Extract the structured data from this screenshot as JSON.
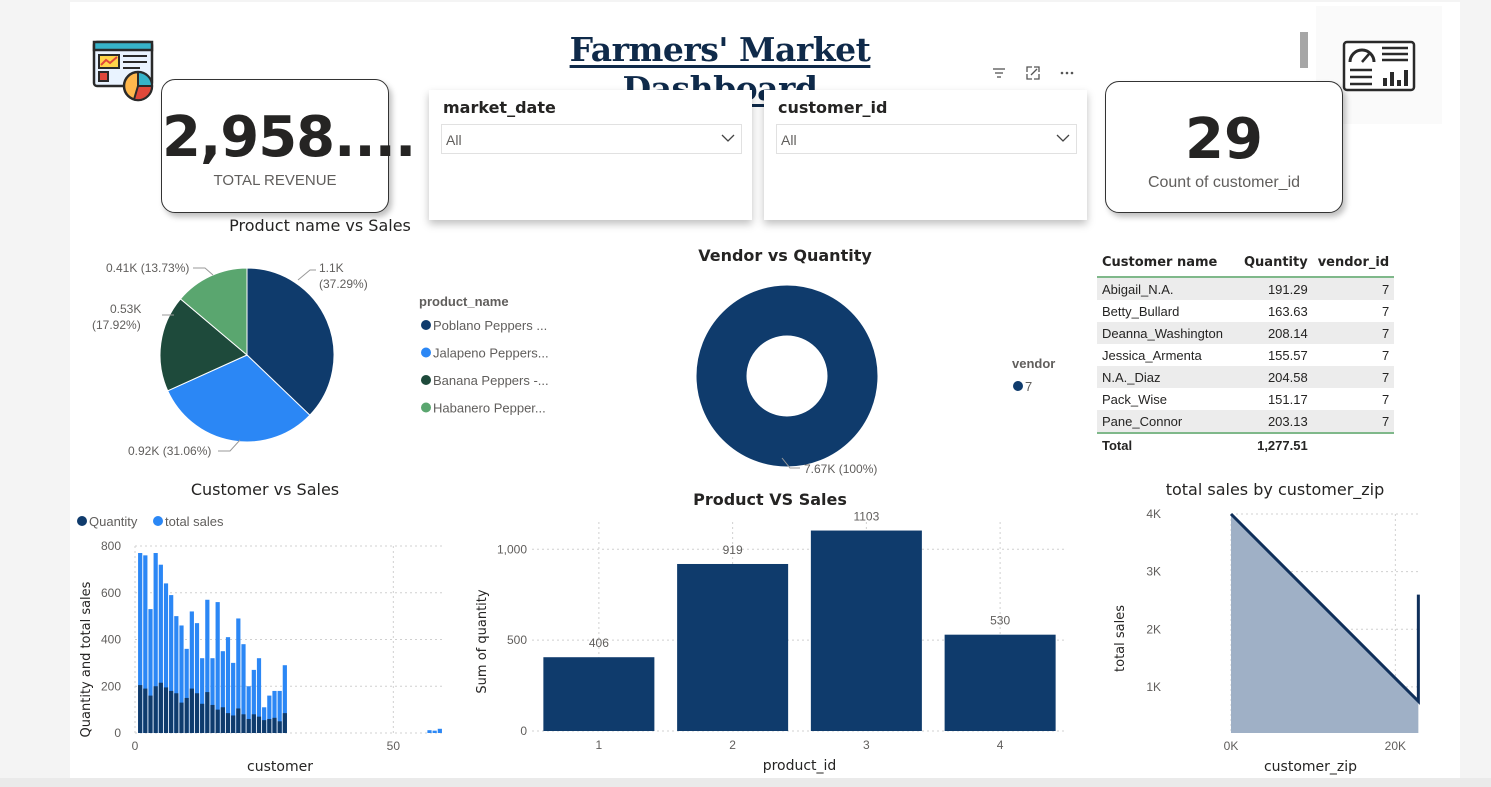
{
  "dashboard": {
    "title": "Farmers' Market Dashboard"
  },
  "kpis": {
    "revenue": {
      "value": "2,958....",
      "label": "TOTAL REVENUE"
    },
    "customers": {
      "value": "29",
      "label": "Count of customer_id"
    }
  },
  "slicers": [
    {
      "header": "market_date",
      "value": "All"
    },
    {
      "header": "customer_id",
      "value": "All"
    }
  ],
  "colors": {
    "navy": "#0f3b6c",
    "blue": "#2b87f5",
    "darkgreen": "#1e4a3b",
    "green": "#5aa66f",
    "area": "#9fb0c6",
    "grid": "#d0d0d0"
  },
  "icons": {
    "toolbar": [
      "filter-icon",
      "focus-mode-icon",
      "more-options-icon"
    ],
    "logo_left": "dashboard-chart-icon",
    "logo_right": "analytics-gauge-icon"
  },
  "table": {
    "columns": [
      "Customer name",
      "Quantity",
      "vendor_id"
    ],
    "rows": [
      [
        "Abigail_N.A.",
        "191.29",
        "7"
      ],
      [
        "Betty_Bullard",
        "163.63",
        "7"
      ],
      [
        "Deanna_Washington",
        "208.14",
        "7"
      ],
      [
        "Jessica_Armenta",
        "155.57",
        "7"
      ],
      [
        "N.A._Diaz",
        "204.58",
        "7"
      ],
      [
        "Pack_Wise",
        "151.17",
        "7"
      ],
      [
        "Pane_Connor",
        "203.13",
        "7"
      ]
    ],
    "total": [
      "Total",
      "1,277.51",
      ""
    ]
  },
  "chart_data": [
    {
      "type": "pie",
      "title": "Product name vs Sales",
      "legend_title": "product_name",
      "legend_position": "right",
      "slices": [
        {
          "name": "Poblano Peppers ...",
          "value": 1.1,
          "label_top": "1.1K",
          "label_bottom": "(37.29%)",
          "color": "#0f3b6c"
        },
        {
          "name": "Jalapeno Peppers...",
          "value": 0.92,
          "label": "0.92K (31.06%)",
          "color": "#2b87f5"
        },
        {
          "name": "Banana Peppers -...",
          "value": 0.53,
          "label_top": "0.53K",
          "label_bottom": "(17.92%)",
          "color": "#1e4a3b"
        },
        {
          "name": "Habanero Pepper...",
          "value": 0.41,
          "label": "0.41K (13.73%)",
          "color": "#5aa66f"
        }
      ]
    },
    {
      "type": "donut",
      "title": "Vendor vs Quantity",
      "legend_title": "vendor",
      "legend_position": "right",
      "slices": [
        {
          "name": "7",
          "value": 7.67,
          "label": "7.67K (100%)",
          "color": "#0f3b6c"
        }
      ]
    },
    {
      "type": "bar",
      "title": "Customer vs Sales",
      "xlabel": "customer",
      "ylabel": "Quantity and total sales",
      "ylim": [
        0,
        800
      ],
      "yticks": [
        "0",
        "200",
        "400",
        "600",
        "800"
      ],
      "xticks": [
        "0",
        "50"
      ],
      "legend_position": "top-left",
      "series": [
        {
          "name": "Quantity",
          "color": "#0f3b6c",
          "x": [
            1,
            2,
            3,
            4,
            5,
            6,
            7,
            8,
            9,
            10,
            11,
            12,
            13,
            14,
            15,
            16,
            17,
            18,
            19,
            20,
            21,
            22,
            23,
            24,
            25,
            26,
            27,
            28,
            29
          ],
          "values": [
            205,
            190,
            160,
            200,
            215,
            195,
            180,
            170,
            130,
            150,
            190,
            170,
            125,
            175,
            120,
            100,
            110,
            85,
            75,
            105,
            80,
            60,
            80,
            70,
            55,
            60,
            65,
            50,
            85
          ]
        },
        {
          "name": "total sales",
          "color": "#2b87f5",
          "x": [
            1,
            2,
            3,
            4,
            5,
            6,
            7,
            8,
            9,
            10,
            11,
            12,
            13,
            14,
            15,
            16,
            17,
            18,
            19,
            20,
            21,
            22,
            23,
            24,
            25,
            26,
            27,
            28,
            29
          ],
          "values": [
            770,
            760,
            530,
            770,
            720,
            640,
            590,
            500,
            460,
            360,
            520,
            470,
            320,
            570,
            320,
            560,
            350,
            410,
            300,
            490,
            380,
            200,
            270,
            320,
            110,
            160,
            180,
            180,
            290
          ]
        },
        {
          "name": "total sales",
          "color": "#2b87f5",
          "x": [
            57,
            58,
            59
          ],
          "values": [
            12,
            10,
            18
          ]
        }
      ]
    },
    {
      "type": "bar",
      "title": "Product VS Sales",
      "xlabel": "product_id",
      "ylabel": "Sum of quantity",
      "ylim": [
        0,
        1150
      ],
      "yticks": [
        "0",
        "500",
        "1,000"
      ],
      "categories": [
        "1",
        "2",
        "3",
        "4"
      ],
      "values": [
        406,
        919,
        1103,
        530
      ],
      "value_labels": [
        "406",
        "919",
        "1103",
        "530"
      ]
    },
    {
      "type": "area",
      "title": "total sales by customer_zip",
      "xlabel": "customer_zip",
      "ylabel": "total sales",
      "xlim": [
        0,
        23000
      ],
      "ylim": [
        200,
        4000
      ],
      "yticks": [
        "1K",
        "2K",
        "3K",
        "4K"
      ],
      "xticks": [
        "0K",
        "20K"
      ],
      "x": [
        0,
        22800,
        22800
      ],
      "values": [
        4000,
        750,
        2600
      ]
    }
  ]
}
